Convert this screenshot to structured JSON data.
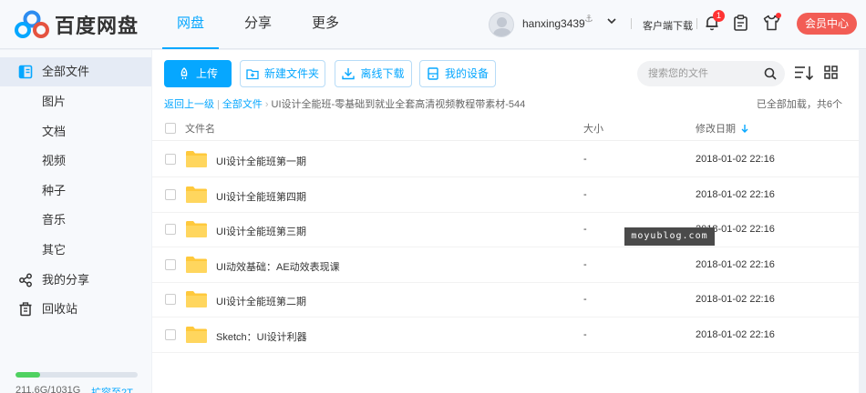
{
  "brand": {
    "name": "百度网盘"
  },
  "nav": [
    "网盘",
    "分享",
    "更多"
  ],
  "user": {
    "name": "hanxing3439",
    "badge": "⚓"
  },
  "header": {
    "client_download": "客户端下载",
    "notifications": "1",
    "vip": "会员中心"
  },
  "sidebar": {
    "items": [
      {
        "label": "全部文件",
        "icon": "folder-list-icon"
      },
      {
        "label": "图片"
      },
      {
        "label": "文档"
      },
      {
        "label": "视频"
      },
      {
        "label": "种子"
      },
      {
        "label": "音乐"
      },
      {
        "label": "其它"
      },
      {
        "label": "我的分享",
        "icon": "share-icon"
      },
      {
        "label": "回收站",
        "icon": "trash-icon"
      }
    ],
    "storage": {
      "used_text": "211.6G/1031G",
      "fraction": 0.205,
      "expand": "扩容至2T"
    }
  },
  "toolbar": {
    "upload": "上传",
    "new_folder": "新建文件夹",
    "offline": "离线下载",
    "devices": "我的设备",
    "search_placeholder": "搜索您的文件"
  },
  "breadcrumb": {
    "back": "返回上一级",
    "all": "全部文件",
    "current": "UI设计全能班-零基础到就业全套高清视频教程带素材-544"
  },
  "loaded_text": "已全部加载，共6个",
  "table": {
    "headers": {
      "name": "文件名",
      "size": "大小",
      "date": "修改日期"
    },
    "rows": [
      {
        "name": "UI设计全能班第一期",
        "size": "-",
        "date": "2018-01-02 22:16"
      },
      {
        "name": "UI设计全能班第四期",
        "size": "-",
        "date": "2018-01-02 22:16"
      },
      {
        "name": "UI设计全能班第三期",
        "size": "-",
        "date": "2018-01-02 22:16"
      },
      {
        "name": "UI动效基础：AE动效表现课",
        "size": "-",
        "date": "2018-01-02 22:16"
      },
      {
        "name": "UI设计全能班第二期",
        "size": "-",
        "date": "2018-01-02 22:16"
      },
      {
        "name": "Sketch：UI设计利器",
        "size": "-",
        "date": "2018-01-02 22:16"
      }
    ]
  },
  "watermark": "moyublog.com",
  "colors": {
    "accent": "#06a7ff",
    "vip": "#f25d55",
    "folder": "#ffc93c",
    "storage": "#4fd160"
  }
}
